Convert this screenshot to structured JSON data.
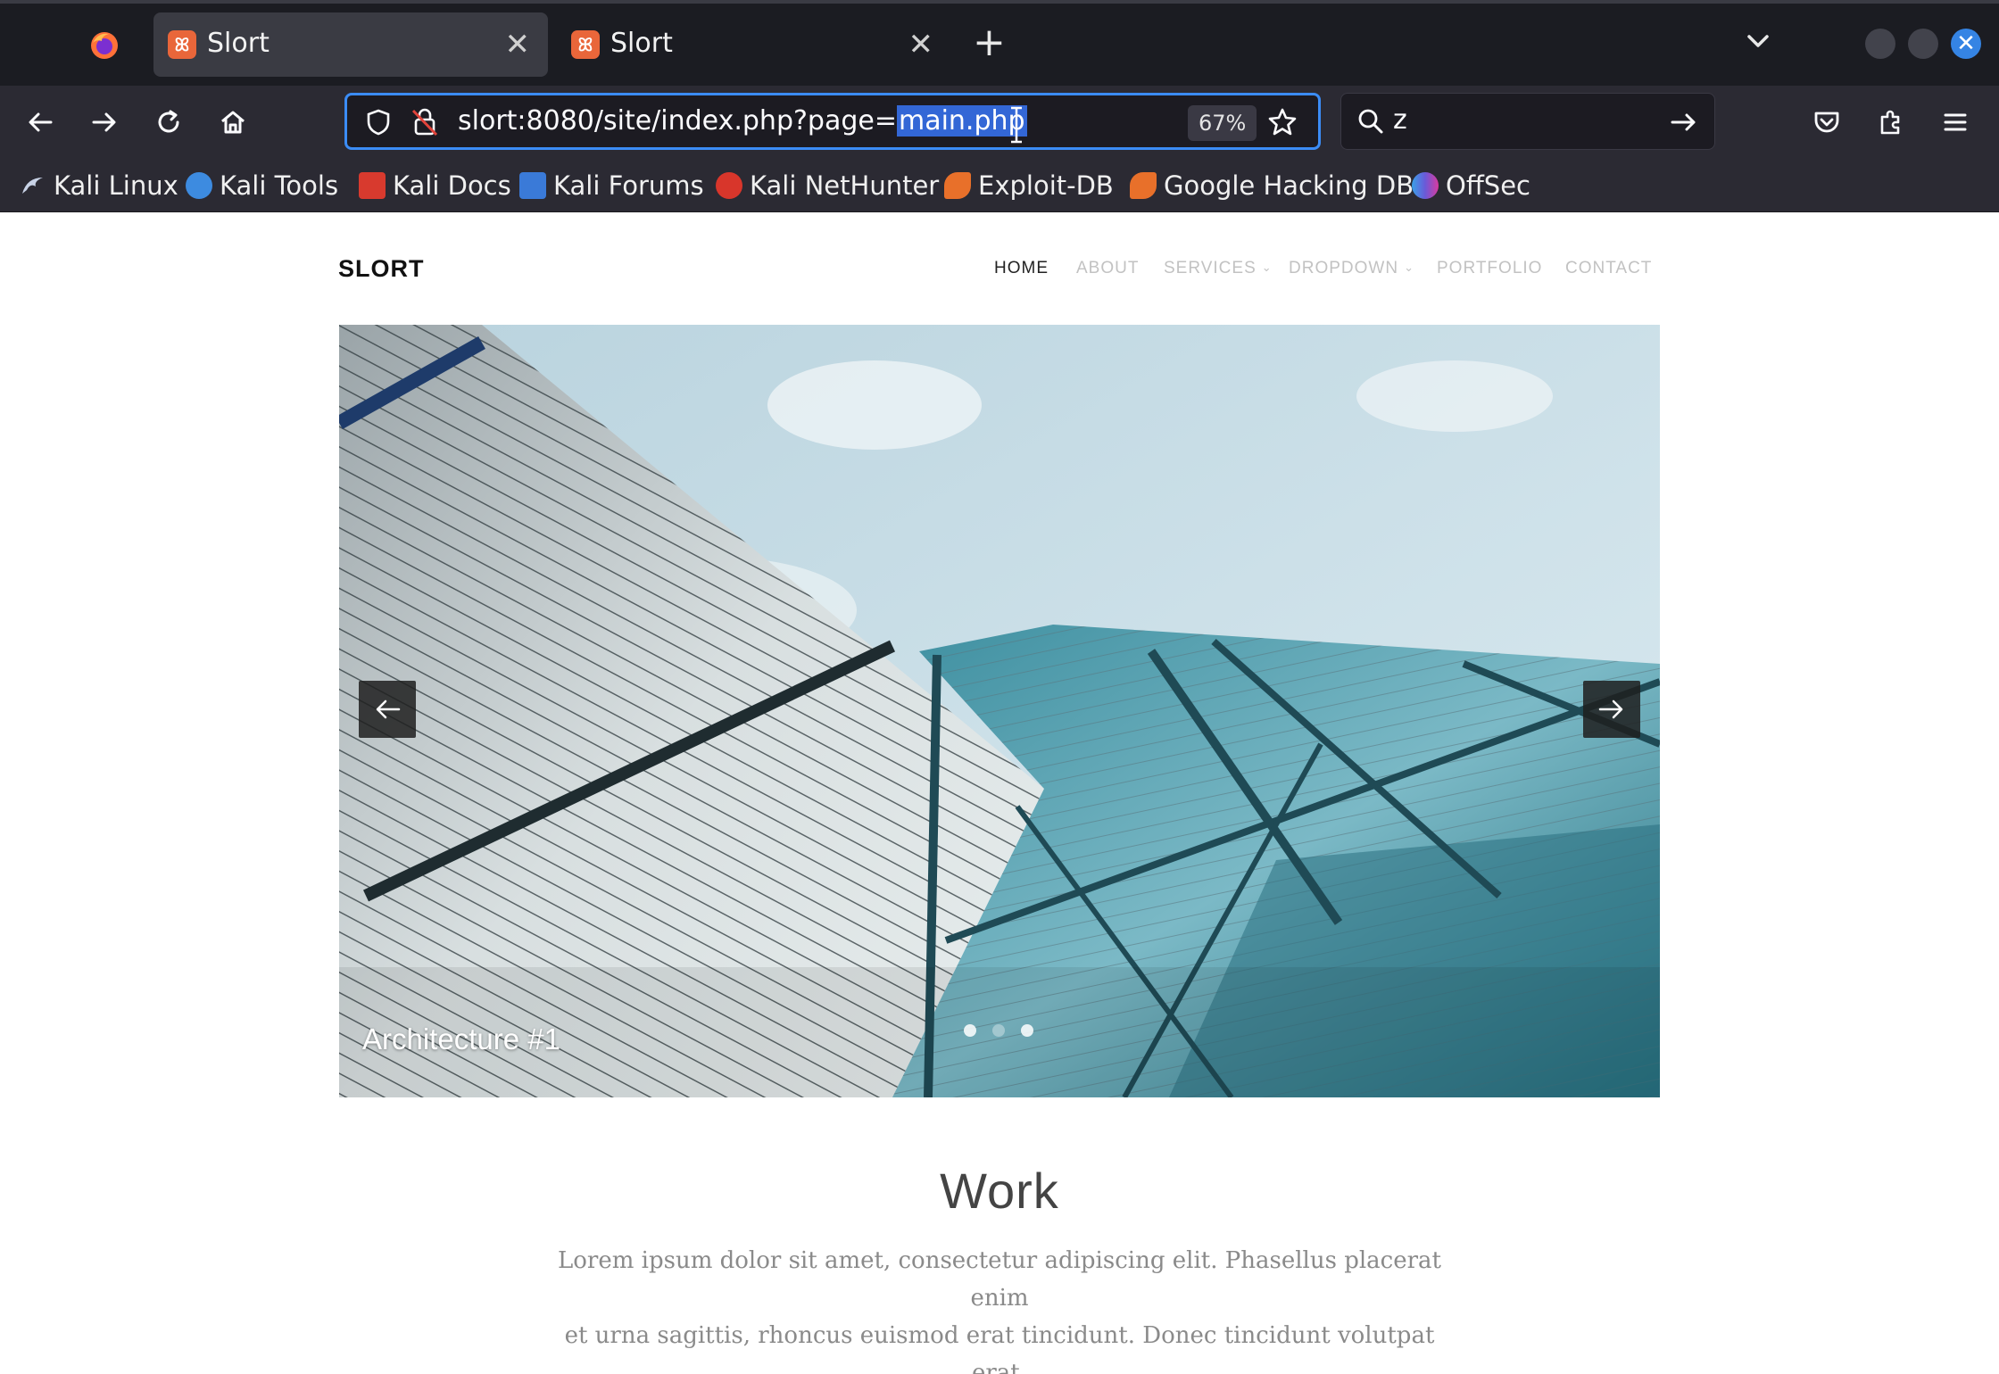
{
  "browser": {
    "tabs": [
      {
        "title": "Slort",
        "active": true
      },
      {
        "title": "Slort",
        "active": false
      }
    ],
    "new_tab_icon": "plus-icon",
    "url": {
      "prefix": "slort:8080/site/index.php?page=",
      "selected": "main.php"
    },
    "zoom": "67%",
    "search": {
      "value": "z"
    },
    "bookmarks": [
      {
        "label": "Kali Linux",
        "color": "#2f7fd0"
      },
      {
        "label": "Kali Tools",
        "color": "#3d8be0"
      },
      {
        "label": "Kali Docs",
        "color": "#d83a2e"
      },
      {
        "label": "Kali Forums",
        "color": "#3a7ad8"
      },
      {
        "label": "Kali NetHunter",
        "color": "#d8362b"
      },
      {
        "label": "Exploit-DB",
        "color": "#e8702a"
      },
      {
        "label": "Google Hacking DB",
        "color": "#e8702a"
      },
      {
        "label": "OffSec",
        "color": "#6a5ad8"
      }
    ],
    "accent": "#3b8cf5"
  },
  "site": {
    "brand": "SLORT",
    "menu": [
      {
        "label": "HOME",
        "active": true
      },
      {
        "label": "ABOUT"
      },
      {
        "label": "SERVICES",
        "dropdown": true
      },
      {
        "label": "DROPDOWN",
        "dropdown": true
      },
      {
        "label": "PORTFOLIO"
      },
      {
        "label": "CONTACT"
      }
    ],
    "slider": {
      "caption": "Architecture #1",
      "dots": 3,
      "active_dot": 1
    },
    "work": {
      "title": "Work",
      "text_line1": "Lorem ipsum dolor sit amet, consectetur adipiscing elit. Phasellus placerat enim",
      "text_line2": "et urna sagittis, rhoncus euismod erat tincidunt. Donec tincidunt volutpat erat."
    }
  }
}
